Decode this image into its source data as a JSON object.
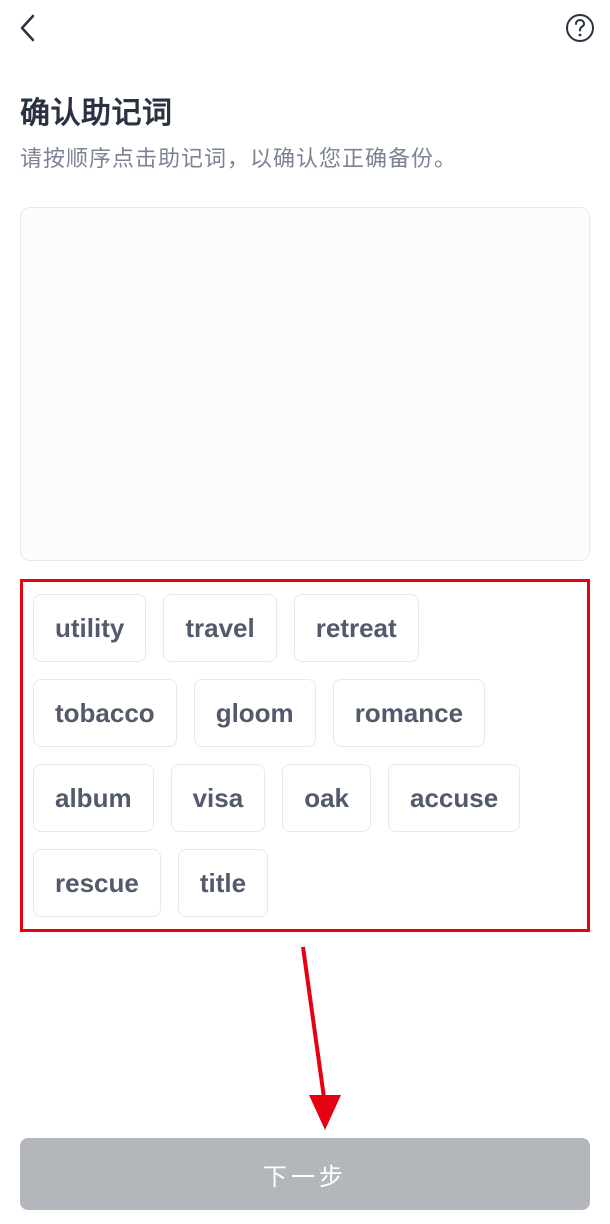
{
  "header": {
    "back_icon": "back",
    "help_icon": "help"
  },
  "page": {
    "title": "确认助记词",
    "subtitle": "请按顺序点击助记词，以确认您正确备份。"
  },
  "words": [
    "utility",
    "travel",
    "retreat",
    "tobacco",
    "gloom",
    "romance",
    "album",
    "visa",
    "oak",
    "accuse",
    "rescue",
    "title"
  ],
  "button": {
    "next_label": "下一步"
  },
  "annotation": {
    "highlight_color": "#E60012"
  }
}
